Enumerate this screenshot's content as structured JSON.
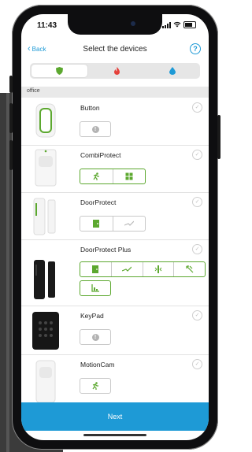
{
  "status": {
    "time": "11:43"
  },
  "nav": {
    "back": "Back",
    "title": "Select the devices",
    "help": "?"
  },
  "tabs": [
    {
      "icon": "shield-icon",
      "color": "#5ca82f"
    },
    {
      "icon": "flame-icon",
      "color": "#e5413b"
    },
    {
      "icon": "water-drop-icon",
      "color": "#1e9ad6"
    }
  ],
  "section": {
    "label": "office"
  },
  "devices": [
    {
      "name": "Button"
    },
    {
      "name": "CombiProtect"
    },
    {
      "name": "DoorProtect"
    },
    {
      "name": "DoorProtect Plus"
    },
    {
      "name": "KeyPad"
    },
    {
      "name": "MotionCam"
    }
  ],
  "footer": {
    "next": "Next"
  },
  "colors": {
    "accent": "#1e9ad6",
    "green": "#5ca82f"
  }
}
